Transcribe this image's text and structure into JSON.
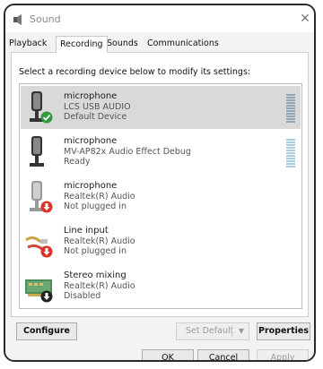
{
  "window": {
    "title": "Sound"
  },
  "tabs": [
    {
      "label": "Playback",
      "active": false
    },
    {
      "label": "Recording",
      "active": true
    },
    {
      "label": "Sounds",
      "active": false
    },
    {
      "label": "Communications",
      "active": false
    }
  ],
  "instruction": "Select a recording device below to modify its settings:",
  "devices": [
    {
      "name": "microphone",
      "driver": "LCS USB AUDIO",
      "status": "Default Device",
      "icon": "microphone-icon",
      "badge": "check-badge",
      "selected": true
    },
    {
      "name": "microphone",
      "driver": "MV-AP82x Audio Effect Debug",
      "status": "Ready",
      "icon": "microphone-icon",
      "badge": "",
      "selected": false
    },
    {
      "name": "microphone",
      "driver": "Realtek(R) Audio",
      "status": "Not plugged in",
      "icon": "microphone-icon",
      "badge": "unplugged-badge",
      "selected": false
    },
    {
      "name": "Line input",
      "driver": "Realtek(R) Audio",
      "status": "Not plugged in",
      "icon": "line-input-icon",
      "badge": "unplugged-badge",
      "selected": false
    },
    {
      "name": "Stereo mixing",
      "driver": "Realtek(R) Audio",
      "status": "Disabled",
      "icon": "stereo-mix-icon",
      "badge": "disabled-badge",
      "selected": false
    }
  ],
  "buttons": {
    "configure": "Configure",
    "set_default": "Set Default",
    "properties": "Properties",
    "ok": "OK",
    "cancel": "Cancel",
    "apply": "Apply"
  },
  "colors": {
    "selected_row": "#d9d9d9",
    "check_badge": "#2e9b3e",
    "unplugged_badge": "#d9342b",
    "meter_active": "#7fa9c9"
  }
}
